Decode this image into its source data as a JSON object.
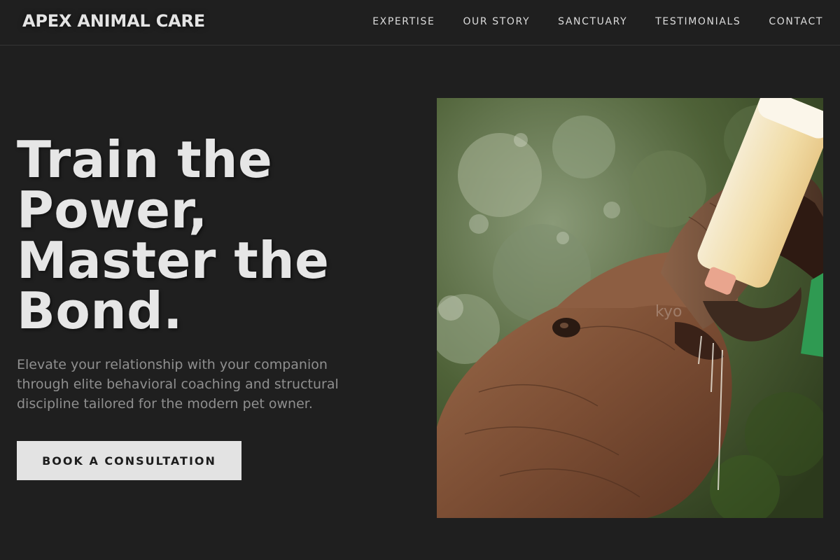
{
  "header": {
    "logo": "APEX ANIMAL CARE",
    "nav": [
      {
        "label": "EXPERTISE"
      },
      {
        "label": "OUR STORY"
      },
      {
        "label": "SANCTUARY"
      },
      {
        "label": "TESTIMONIALS"
      },
      {
        "label": "CONTACT"
      }
    ]
  },
  "hero": {
    "title_lines": [
      "Train the",
      "Power,",
      "Master the",
      "Bond."
    ],
    "subtitle": "Elevate your relationship with your companion through elite behavioral coaching and structural discipline tailored for the modern pet owner.",
    "cta_label": "BOOK A CONSULTATION",
    "image": {
      "subject": "keeper-bottle-feeding-baby-elephant",
      "watermark": "kyo"
    }
  },
  "colors": {
    "background": "#1f1f1f",
    "text_primary": "#e6e6e6",
    "text_muted": "#8f8f8f",
    "button_bg": "#e3e3e3",
    "button_text": "#1d1d1d"
  }
}
